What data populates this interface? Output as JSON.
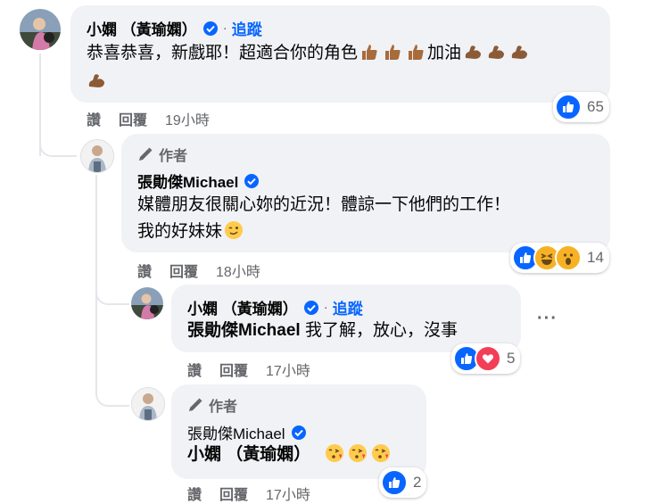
{
  "comment1": {
    "name": "小嫻 （黃瑜嫻）",
    "follow": "追蹤",
    "line1": "恭喜恭喜，新戲耶！超適合你的角色",
    "line1_suffix": "加油",
    "actions": {
      "like": "讚",
      "reply": "回覆",
      "time": "19小時"
    },
    "reaction_count": "65"
  },
  "comment2": {
    "author_badge": "作者",
    "name": "張勛傑Michael",
    "line1": "媒體朋友很關心妳的近況！體諒一下他們的工作！",
    "line2": "我的好妹妹",
    "actions": {
      "like": "讚",
      "reply": "回覆",
      "time": "18小時"
    },
    "reaction_count": "14"
  },
  "comment3": {
    "name": "小嫻 （黃瑜嫻）",
    "follow": "追蹤",
    "line1": "張勛傑Michael",
    "line1_suffix": "我了解，放心，沒事",
    "more": "···",
    "actions": {
      "like": "讚",
      "reply": "回覆",
      "time": "17小時"
    },
    "reaction_count": "5"
  },
  "comment4": {
    "author_badge": "作者",
    "name": "張勛傑Michael",
    "line1": "小嫻 （黃瑜嫻）",
    "actions": {
      "like": "讚",
      "reply": "回覆",
      "time": "17小時"
    },
    "reaction_count": "2"
  },
  "colors": {
    "bubble": "#f0f2f5",
    "link": "#0866ff",
    "secondary": "#65676b",
    "like": "#0866ff",
    "heart": "#f33e58",
    "haha": "#f7b125"
  }
}
